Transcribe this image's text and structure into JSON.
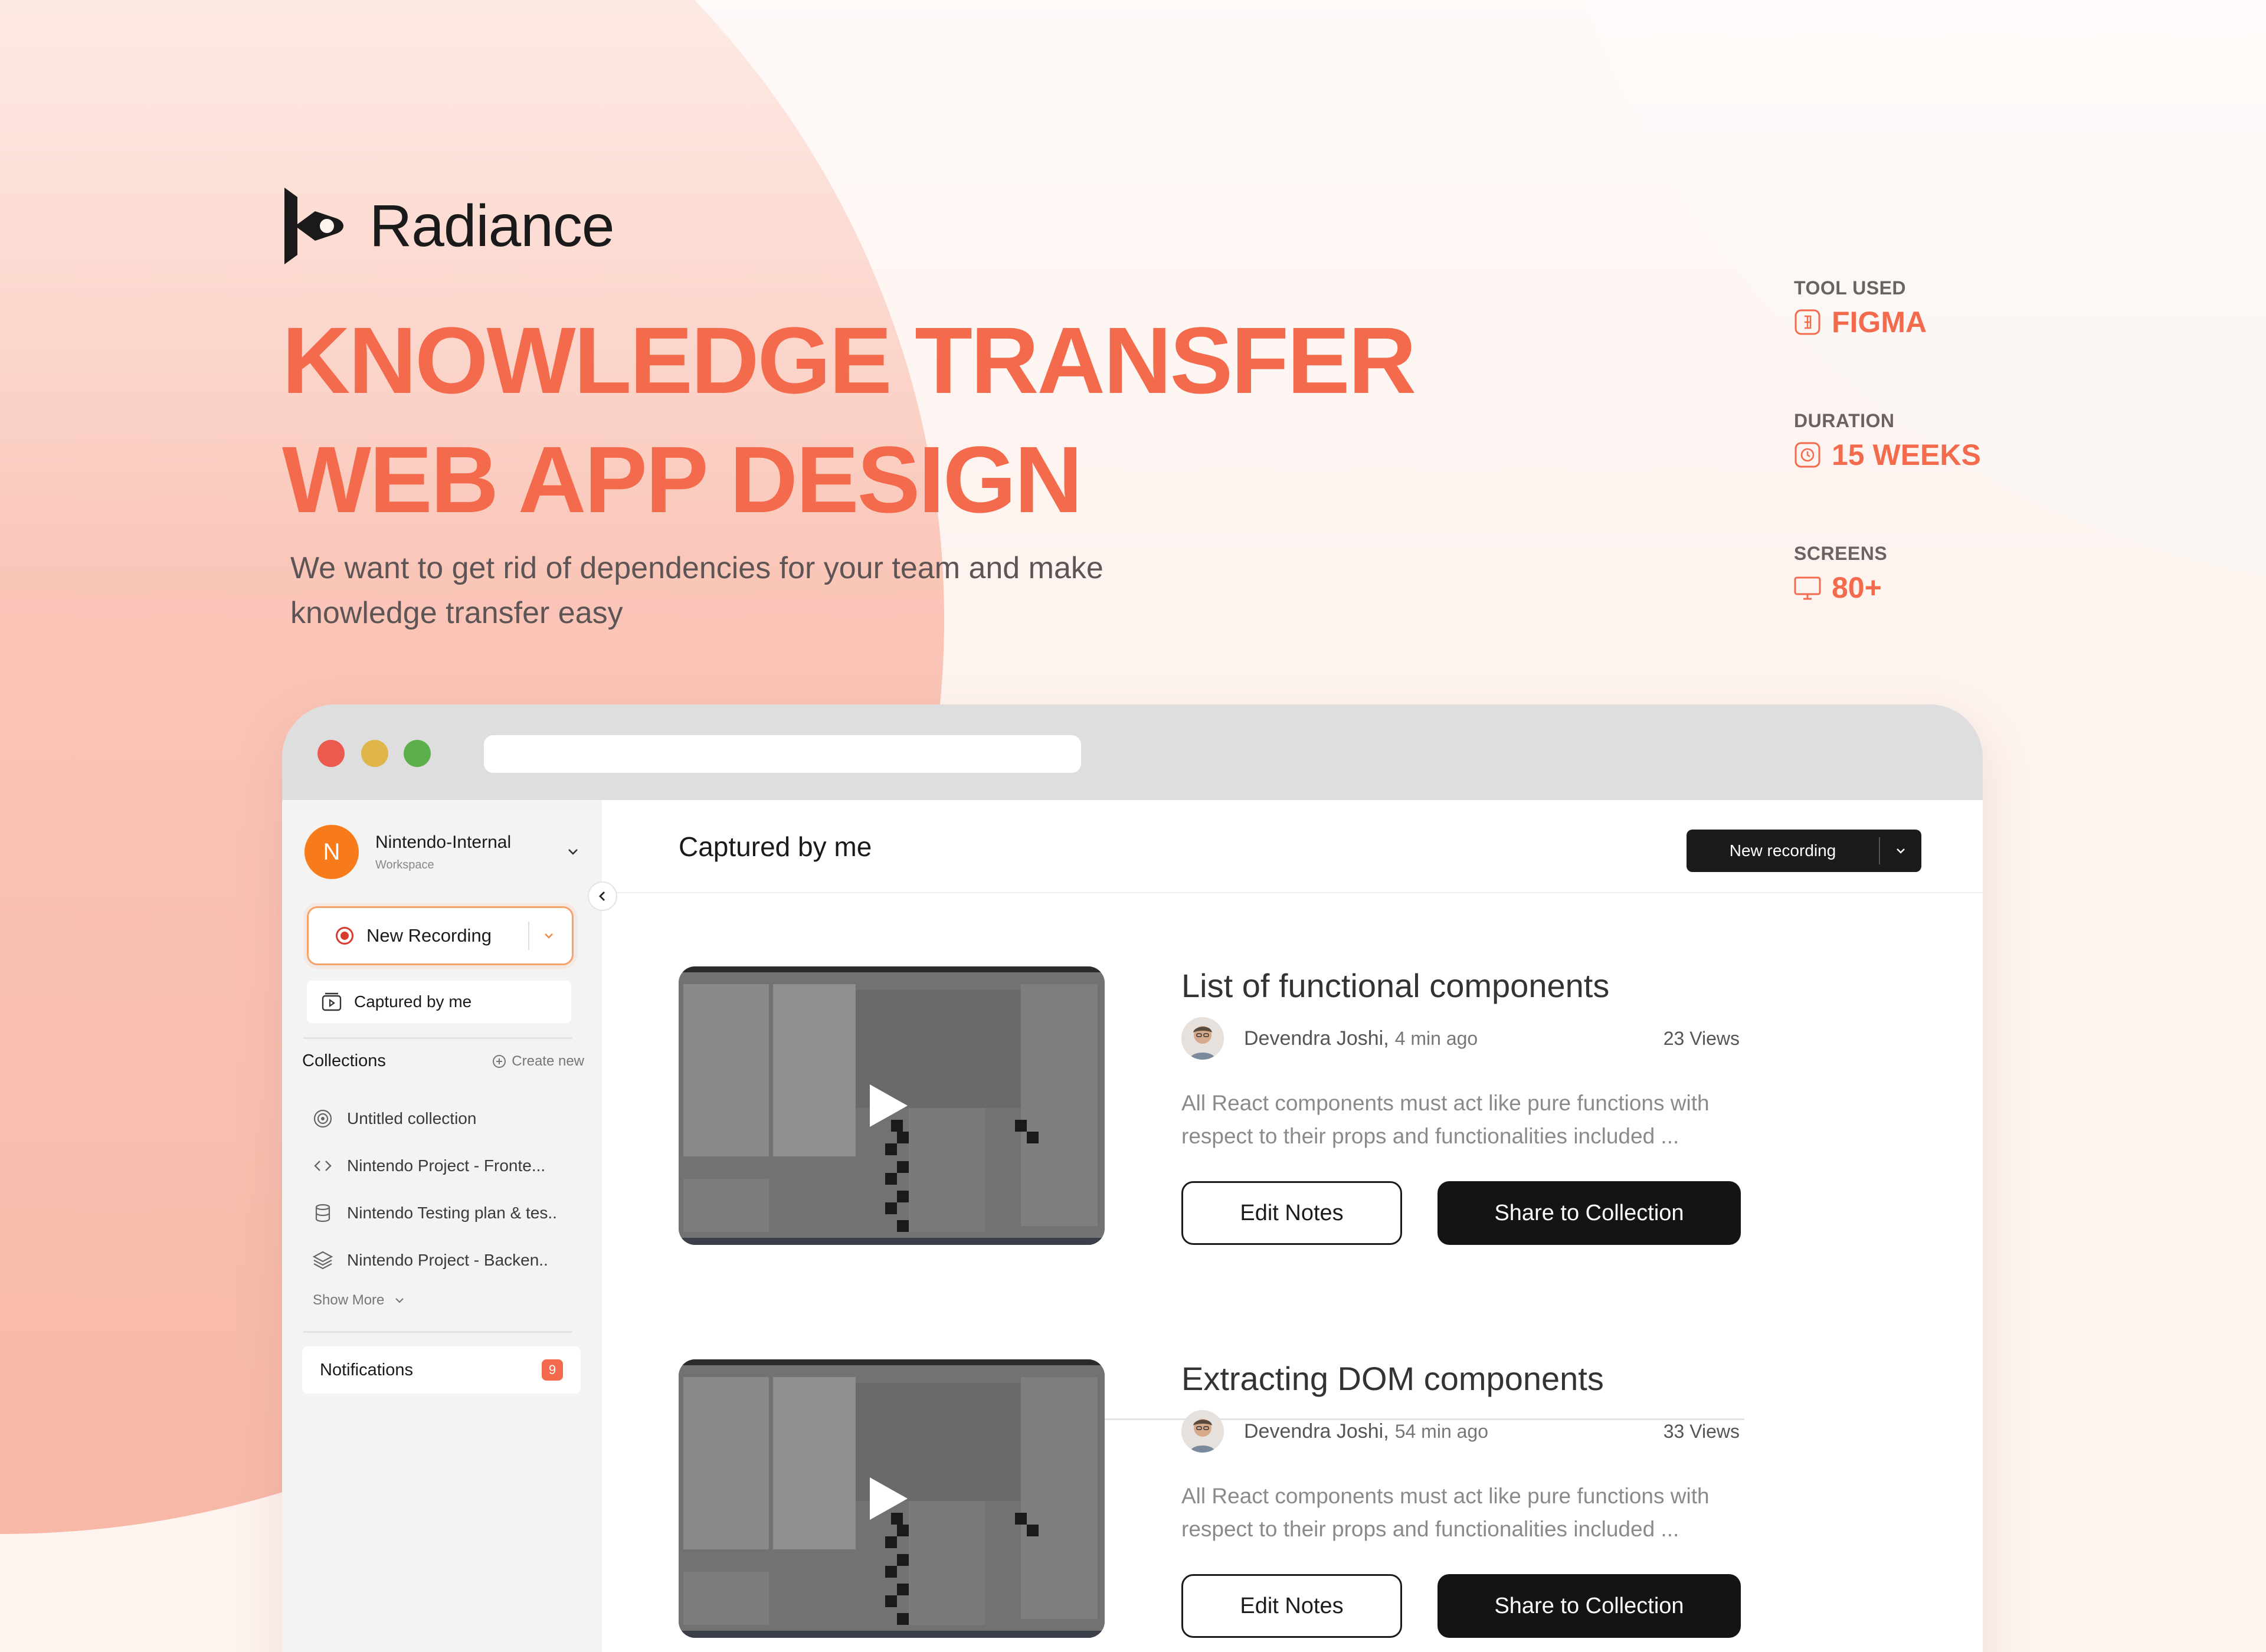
{
  "brand": {
    "name": "Radiance"
  },
  "hero": {
    "title_line1": "KNOWLEDGE TRANSFER",
    "title_line2": "WEB APP DESIGN",
    "subtitle": "We want to get rid of dependencies for your team and make knowledge transfer easy"
  },
  "meta": [
    {
      "label": "TOOL USED",
      "value": "FIGMA",
      "icon": "figma-icon"
    },
    {
      "label": "DURATION",
      "value": "15 WEEKS",
      "icon": "clock-icon"
    },
    {
      "label": "SCREENS",
      "value": "80+",
      "icon": "monitor-icon"
    }
  ],
  "colors": {
    "accent": "#f36b4c",
    "dark": "#141414",
    "workspace_avatar": "#f77b1a",
    "record": "#d93b2f"
  },
  "sidebar": {
    "workspace": {
      "initial": "N",
      "name": "Nintendo-Internal",
      "sub": "Workspace"
    },
    "new_recording": "New Recording",
    "captured": "Captured by me",
    "collections_title": "Collections",
    "create_new": "Create new",
    "collections": [
      {
        "label": "Untitled collection",
        "icon": "target-icon"
      },
      {
        "label": "Nintendo Project - Fronte...",
        "icon": "code-icon"
      },
      {
        "label": "Nintendo Testing plan & tes..",
        "icon": "database-icon"
      },
      {
        "label": "Nintendo Project - Backen..",
        "icon": "layers-icon"
      }
    ],
    "show_more": "Show More",
    "notifications": "Notifications",
    "notif_count": "9"
  },
  "main": {
    "title": "Captured by me",
    "new_recording": "New recording",
    "cards": [
      {
        "title": "List of functional components",
        "author": "Devendra Joshi,",
        "time": "4 min ago",
        "views": "23 Views",
        "desc": "All React components must act like pure functions with respect to their props and functionalities included ...",
        "edit": "Edit Notes",
        "share": "Share to Collection"
      },
      {
        "title": "Extracting DOM components",
        "author": "Devendra Joshi,",
        "time": "54 min ago",
        "views": "33 Views",
        "desc": "All React components must act like pure functions with respect to their props and functionalities included ...",
        "edit": "Edit Notes",
        "share": "Share to Collection"
      }
    ]
  }
}
